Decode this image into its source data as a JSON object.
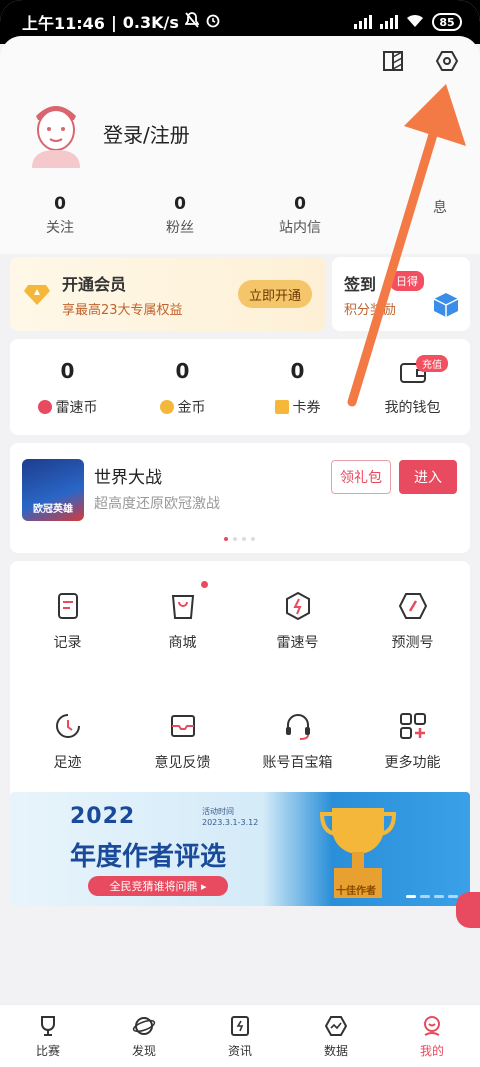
{
  "status_bar": {
    "time": "上午11:46",
    "speed": "0.3K/s",
    "battery": "85"
  },
  "profile": {
    "login_label": "登录/注册"
  },
  "stats": [
    {
      "num": "0",
      "label": "关注"
    },
    {
      "num": "0",
      "label": "粉丝"
    },
    {
      "num": "0",
      "label": "站内信"
    },
    {
      "num": "",
      "label": "息"
    }
  ],
  "vip": {
    "title": "开通会员",
    "subtitle": "享最高23大专属权益",
    "button": "立即开通"
  },
  "sign": {
    "title": "签到",
    "tag": "日得",
    "subtitle": "积分奖励"
  },
  "wallet": {
    "items": [
      {
        "num": "0",
        "label": "雷速币"
      },
      {
        "num": "0",
        "label": "金币"
      },
      {
        "num": "0",
        "label": "卡券"
      },
      {
        "num": "",
        "label": "我的钱包"
      }
    ],
    "badge": "充值"
  },
  "game": {
    "thumb_text": "欧冠英雄",
    "name": "世界大战",
    "desc": "超高度还原欧冠激战",
    "gift_button": "领礼包",
    "enter_button": "进入"
  },
  "features": [
    {
      "label": "记录",
      "icon": "record-icon"
    },
    {
      "label": "商城",
      "icon": "shop-icon"
    },
    {
      "label": "雷速号",
      "icon": "leisu-icon"
    },
    {
      "label": "预测号",
      "icon": "predict-icon"
    },
    {
      "label": "足迹",
      "icon": "history-icon"
    },
    {
      "label": "意见反馈",
      "icon": "feedback-icon"
    },
    {
      "label": "账号百宝箱",
      "icon": "headset-icon"
    },
    {
      "label": "更多功能",
      "icon": "more-icon"
    }
  ],
  "banner": {
    "year": "2022",
    "date_label": "活动时间",
    "date": "2023.3.1-3.12",
    "title": "年度作者评选",
    "pill": "全民竞猜谁将问鼎 ▸",
    "trophy_text": "十佳作者"
  },
  "tabs": [
    {
      "label": "比赛",
      "icon": "trophy-icon"
    },
    {
      "label": "发现",
      "icon": "planet-icon"
    },
    {
      "label": "资讯",
      "icon": "news-icon"
    },
    {
      "label": "数据",
      "icon": "data-icon"
    },
    {
      "label": "我的",
      "icon": "profile-icon"
    }
  ],
  "colors": {
    "accent": "#e84a5f",
    "arrow": "#f37a45"
  }
}
